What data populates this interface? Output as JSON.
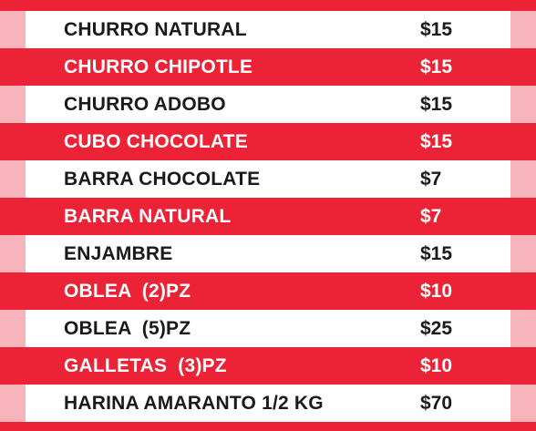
{
  "menu": {
    "items": [
      {
        "name": "CHURRO NATURAL",
        "price": "$15"
      },
      {
        "name": "CHURRO CHIPOTLE",
        "price": "$15"
      },
      {
        "name": "CHURRO ADOBO",
        "price": "$15"
      },
      {
        "name": "CUBO CHOCOLATE",
        "price": "$15"
      },
      {
        "name": "BARRA CHOCOLATE",
        "price": "$7"
      },
      {
        "name": "BARRA NATURAL",
        "price": "$7"
      },
      {
        "name": "ENJAMBRE",
        "price": "$15"
      },
      {
        "name": "OBLEA  (2)PZ",
        "price": "$10"
      },
      {
        "name": "OBLEA  (5)PZ",
        "price": "$25"
      },
      {
        "name": "GALLETAS  (3)PZ",
        "price": "$10"
      },
      {
        "name": "HARINA AMARANTO 1/2 KG",
        "price": "$70"
      }
    ]
  },
  "colors": {
    "red": "#ec2236",
    "light_row": "#ffffff",
    "edge_pink": "#f7b4ba",
    "dark_text": "#1a1a1a",
    "light_text": "#ffffff"
  }
}
